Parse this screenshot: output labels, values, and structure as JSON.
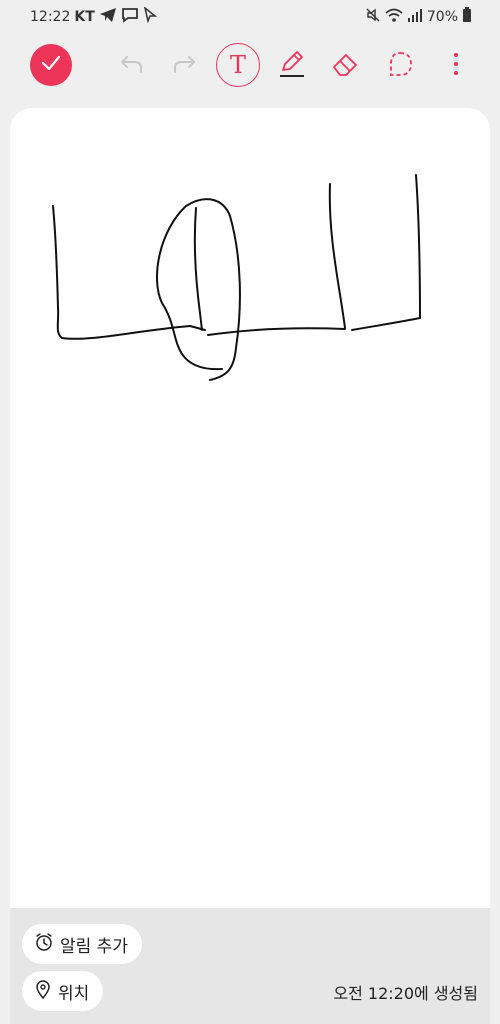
{
  "status": {
    "time": "12:22",
    "carrier": "KT",
    "battery": "70%"
  },
  "toolbar": {
    "text_tool_glyph": "T",
    "accent": "#ec3559"
  },
  "bottom": {
    "alarm_label": "알림 추가",
    "location_label": "위치",
    "created_label": "오전 12:20에 생성됨"
  },
  "icons": [
    "telegram-icon",
    "message-icon",
    "cursor-icon",
    "mute-icon",
    "wifi-icon",
    "signal-icon",
    "battery-icon",
    "check-icon",
    "undo-icon",
    "redo-icon",
    "text-tool-icon",
    "pen-icon",
    "eraser-icon",
    "lasso-icon",
    "more-icon",
    "alarm-icon",
    "location-pin-icon"
  ]
}
